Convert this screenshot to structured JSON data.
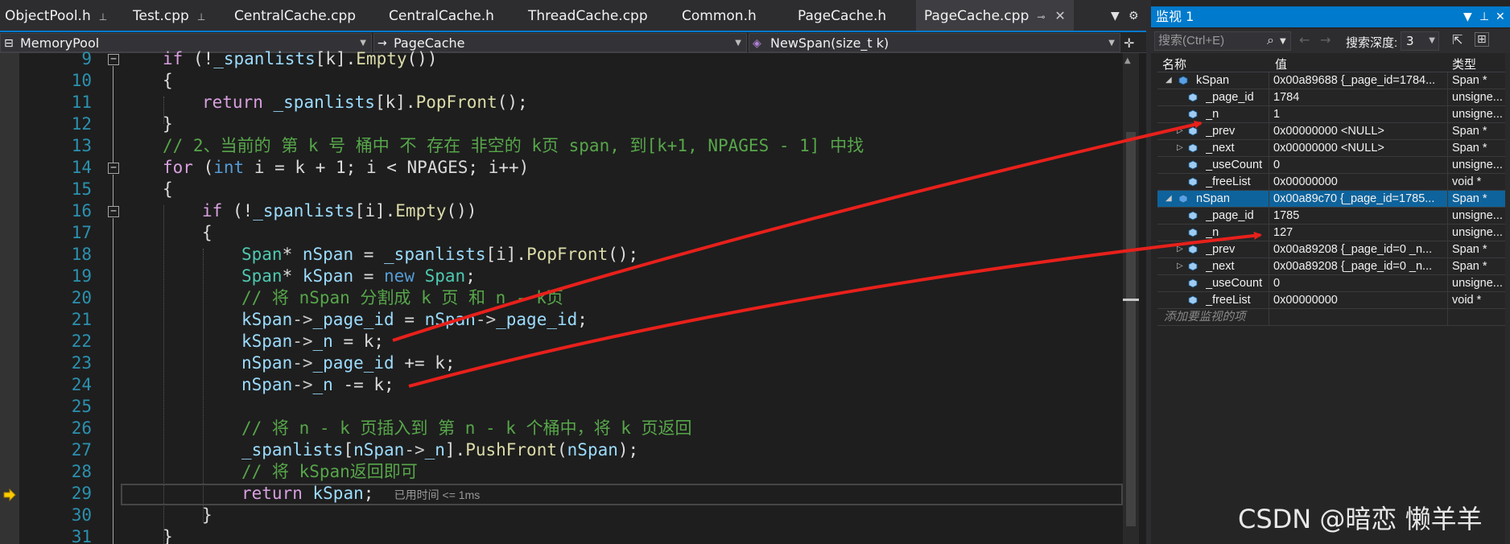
{
  "tabs": [
    {
      "label": "ObjectPool.h",
      "pinned": true
    },
    {
      "label": "Test.cpp",
      "pinned": true
    },
    {
      "label": "CentralCache.cpp",
      "pinned": false
    },
    {
      "label": "CentralCache.h",
      "pinned": false
    },
    {
      "label": "ThreadCache.cpp",
      "pinned": false
    },
    {
      "label": "Common.h",
      "pinned": false
    },
    {
      "label": "PageCache.h",
      "pinned": false
    },
    {
      "label": "PageCache.cpp",
      "pinned": false,
      "active": true
    }
  ],
  "navbar": {
    "project": "MemoryPool",
    "scope": "PageCache",
    "member": "NewSpan(size_t k)"
  },
  "code_lines": [
    {
      "n": "9"
    },
    {
      "n": "10"
    },
    {
      "n": "11"
    },
    {
      "n": "12"
    },
    {
      "n": "13"
    },
    {
      "n": "14"
    },
    {
      "n": "15"
    },
    {
      "n": "16"
    },
    {
      "n": "17"
    },
    {
      "n": "18"
    },
    {
      "n": "19"
    },
    {
      "n": "20"
    },
    {
      "n": "21"
    },
    {
      "n": "22"
    },
    {
      "n": "23"
    },
    {
      "n": "24"
    },
    {
      "n": "25"
    },
    {
      "n": "26"
    },
    {
      "n": "27"
    },
    {
      "n": "28"
    },
    {
      "n": "29"
    },
    {
      "n": "30"
    },
    {
      "n": "31"
    }
  ],
  "code": {
    "l9": "if (!_spanlists[k].Empty())",
    "l13": "// 2、当前的 第 k 号 桶中 不 存在 非空的 k页 span, 到[k+1, NPAGES - 1] 中找",
    "l20": "// 将 nSpan 分割成 k 页 和 n - k页",
    "l26": "// 将 n - k 页插入到 第 n - k 个桶中，将 k 页返回",
    "l28": "// 将 kSpan返回即可",
    "perf_tip": "已用时间 <= 1ms"
  },
  "watch": {
    "title": "监视 1",
    "search_placeholder": "搜索(Ctrl+E)",
    "depth_label": "搜索深度:",
    "depth_value": "3",
    "columns": {
      "name": "名称",
      "value": "值",
      "type": "类型"
    },
    "rows": [
      {
        "name": "kSpan",
        "value": "0x00a89688 {_page_id=1784...",
        "type": "Span *",
        "level": 0,
        "expanded": true
      },
      {
        "name": "_page_id",
        "value": "1784",
        "type": "unsigne...",
        "level": 1
      },
      {
        "name": "_n",
        "value": "1",
        "type": "unsigne...",
        "level": 1
      },
      {
        "name": "_prev",
        "value": "0x00000000 <NULL>",
        "type": "Span *",
        "level": 1,
        "collapsed": true
      },
      {
        "name": "_next",
        "value": "0x00000000 <NULL>",
        "type": "Span *",
        "level": 1,
        "collapsed": true
      },
      {
        "name": "_useCount",
        "value": "0",
        "type": "unsigne...",
        "level": 1
      },
      {
        "name": "_freeList",
        "value": "0x00000000",
        "type": "void *",
        "level": 1
      },
      {
        "name": "nSpan",
        "value": "0x00a89c70 {_page_id=1785...",
        "type": "Span *",
        "level": 0,
        "expanded": true,
        "selected": true
      },
      {
        "name": "_page_id",
        "value": "1785",
        "type": "unsigne...",
        "level": 1
      },
      {
        "name": "_n",
        "value": "127",
        "type": "unsigne...",
        "level": 1
      },
      {
        "name": "_prev",
        "value": "0x00a89208 {_page_id=0 _n...",
        "type": "Span *",
        "level": 1,
        "collapsed": true
      },
      {
        "name": "_next",
        "value": "0x00a89208 {_page_id=0 _n...",
        "type": "Span *",
        "level": 1,
        "collapsed": true
      },
      {
        "name": "_useCount",
        "value": "0",
        "type": "unsigne...",
        "level": 1
      },
      {
        "name": "_freeList",
        "value": "0x00000000",
        "type": "void *",
        "level": 1
      }
    ],
    "add_watch_placeholder": "添加要监视的项"
  },
  "watermark": "CSDN @暗恋 懒羊羊",
  "colors": {
    "accent": "#007acc",
    "annotation_arrow": "#e8201b",
    "selection": "#0e639c"
  }
}
